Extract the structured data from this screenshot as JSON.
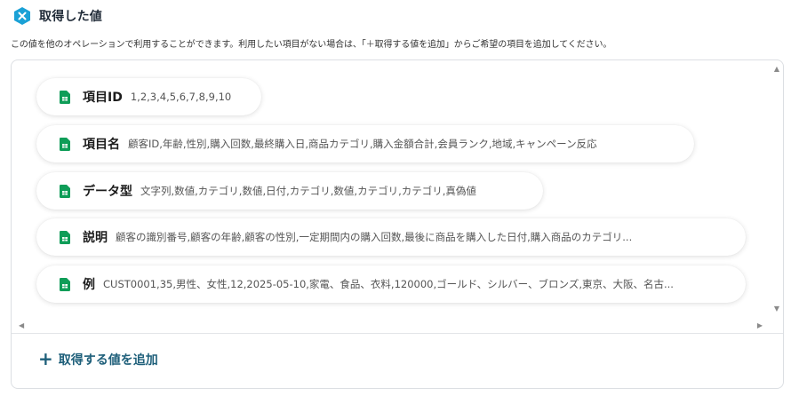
{
  "header": {
    "title": "取得した値",
    "icon": "x-hexagon-icon",
    "icon_color": "#1aa1d6"
  },
  "description": "この値を他のオペレーションで利用することができます。利用したい項目がない場合は、「＋取得する値を追加」からご希望の項目を追加してください。",
  "items": [
    {
      "key": "項目ID",
      "value": "1,2,3,4,5,6,7,8,9,10",
      "icon": "google-sheets-icon"
    },
    {
      "key": "項目名",
      "value": "顧客ID,年齢,性別,購入回数,最終購入日,商品カテゴリ,購入金額合計,会員ランク,地域,キャンペーン反応",
      "icon": "google-sheets-icon"
    },
    {
      "key": "データ型",
      "value": "文字列,数値,カテゴリ,数値,日付,カテゴリ,数値,カテゴリ,カテゴリ,真偽値",
      "icon": "google-sheets-icon"
    },
    {
      "key": "説明",
      "value": "顧客の識別番号,顧客の年齢,顧客の性別,一定期間内の購入回数,最後に商品を購入した日付,購入商品のカテゴリ...",
      "icon": "google-sheets-icon"
    },
    {
      "key": "例",
      "value": "CUST0001,35,男性、女性,12,2025-05-10,家電、食品、衣料,120000,ゴールド、シルバー、ブロンズ,東京、大阪、名古...",
      "icon": "google-sheets-icon"
    }
  ],
  "add_button": {
    "label": "取得する値を追加",
    "icon": "plus-icon",
    "color": "#1e5f7a"
  },
  "sheets_color": "#0f9d58"
}
